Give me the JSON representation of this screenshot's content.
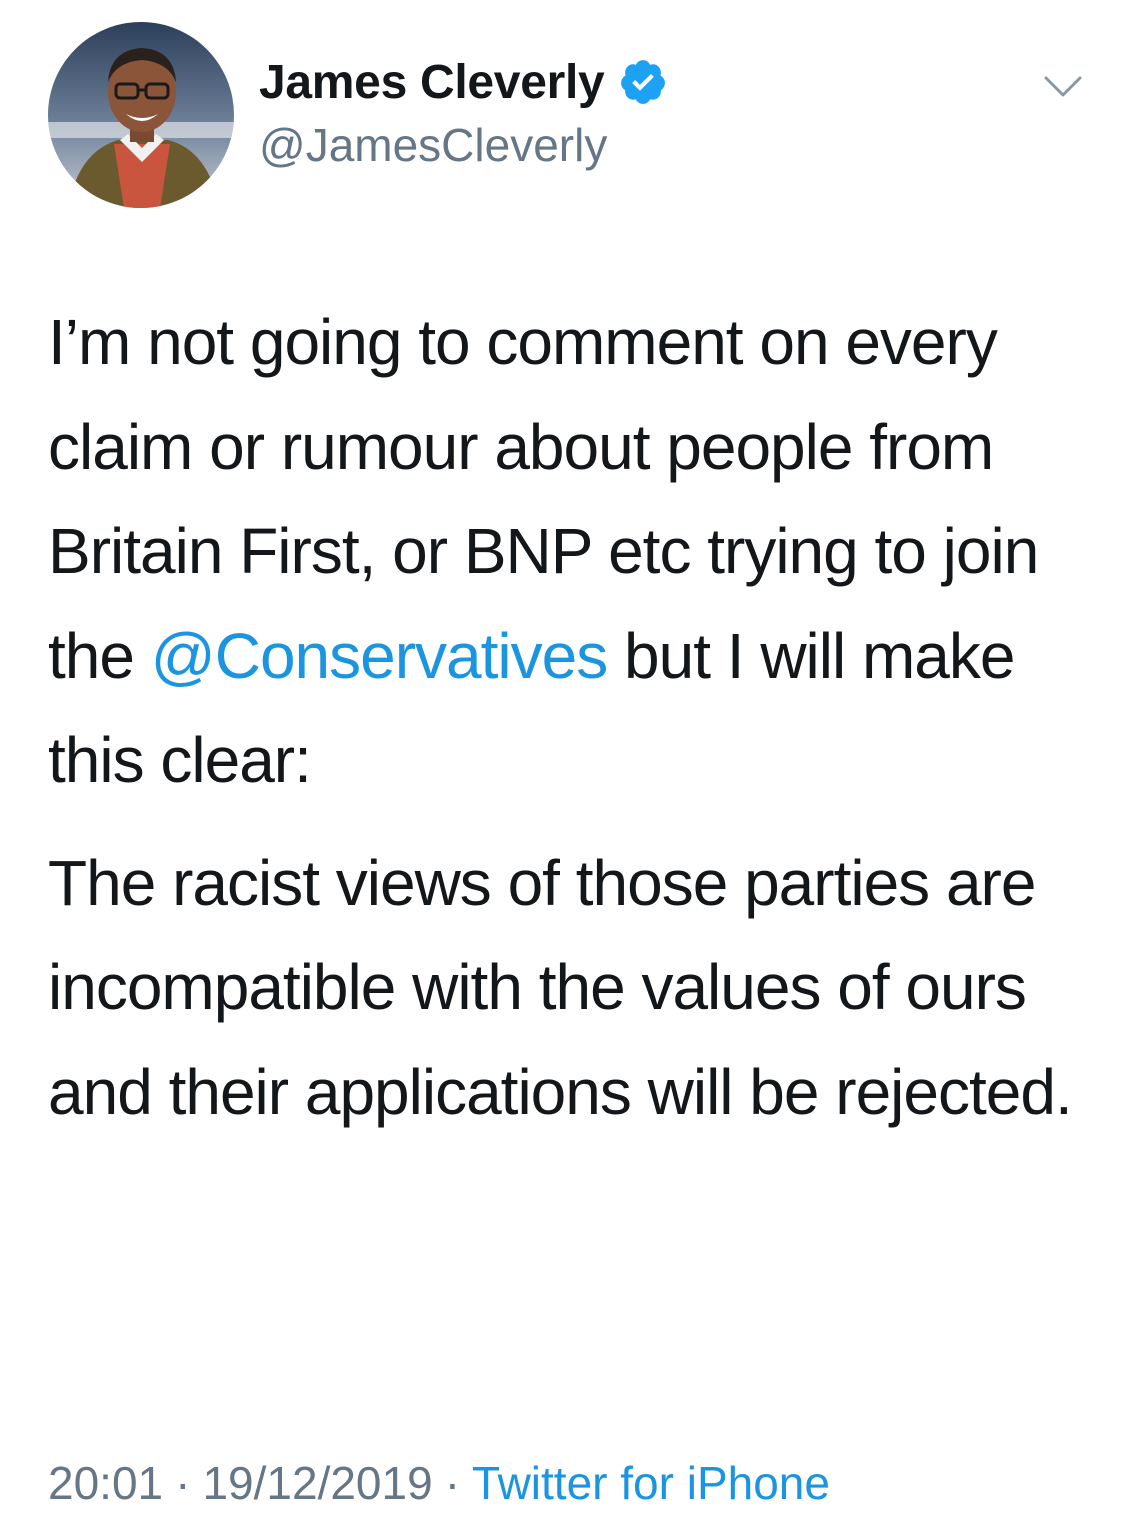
{
  "author": {
    "display_name": "James Cleverly",
    "handle": "@JamesCleverly",
    "verified": true,
    "avatar_icon": "profile-photo"
  },
  "menu": {
    "icon": "chevron-down-icon"
  },
  "tweet": {
    "paragraph_1": {
      "text_before": "I’m not going to comment on every claim or rumour about people from Britain First, or BNP etc trying to join the ",
      "mention": "@Conservatives",
      "text_after": " but I will make this clear:"
    },
    "paragraph_2": "The racist views of those parties are incompatible with the values of ours and their applications will be rejected."
  },
  "meta": {
    "time": "20:01",
    "separator": "·",
    "date": "19/12/2019",
    "source": "Twitter for iPhone"
  },
  "colors": {
    "link": "#1b95e0",
    "muted": "#657786",
    "text": "#14171a",
    "verified_badge": "#1da1f2"
  }
}
